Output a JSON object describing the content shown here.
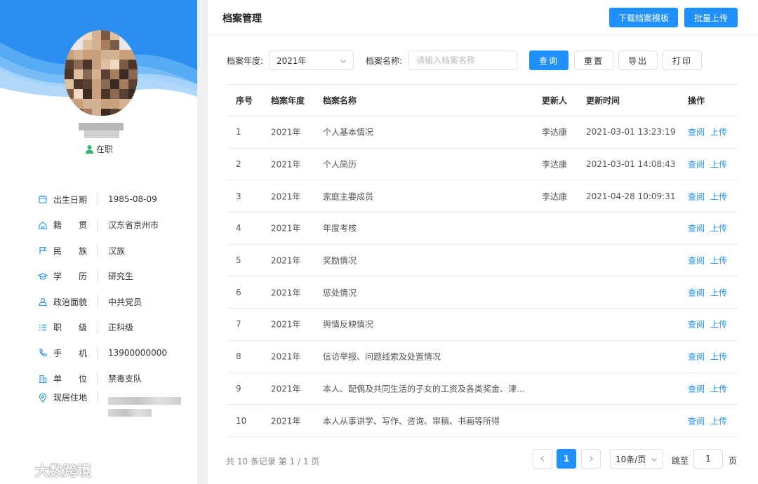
{
  "profile": {
    "status": "在职",
    "fields": [
      {
        "icon": "calendar-icon",
        "label": "出生日期",
        "value": "1985-08-09"
      },
      {
        "icon": "home-icon",
        "label": "籍　　贯",
        "value": "汉东省京州市"
      },
      {
        "icon": "flag-icon",
        "label": "民　　族",
        "value": "汉族"
      },
      {
        "icon": "graduation-cap-icon",
        "label": "学　　历",
        "value": "研究生"
      },
      {
        "icon": "party-icon",
        "label": "政治面貌",
        "value": "中共党员"
      },
      {
        "icon": "list-icon",
        "label": "职　　级",
        "value": "正科级"
      },
      {
        "icon": "phone-icon",
        "label": "手　　机",
        "value": "13900000000"
      },
      {
        "icon": "building-icon",
        "label": "单　　位",
        "value": "禁毒支队"
      },
      {
        "icon": "location-icon",
        "label": "现居住地",
        "value": ""
      }
    ]
  },
  "watermark": "大数跨境",
  "header": {
    "title": "档案管理",
    "download_label": "下载档案模板",
    "batch_upload_label": "批量上传"
  },
  "filters": {
    "year_label": "档案年度:",
    "year_value": "2021年",
    "name_label": "档案名称:",
    "name_placeholder": "请输入档案名称",
    "query_label": "查询",
    "reset_label": "重置",
    "export_label": "导出",
    "print_label": "打印"
  },
  "table": {
    "columns": [
      "序号",
      "档案年度",
      "档案名称",
      "更新人",
      "更新时间",
      "操作"
    ],
    "view_label": "查阅",
    "upload_label": "上传",
    "rows": [
      {
        "idx": "1",
        "year": "2021年",
        "name": "个人基本情况",
        "user": "李达康",
        "time": "2021-03-01 13:23:19"
      },
      {
        "idx": "2",
        "year": "2021年",
        "name": "个人简历",
        "user": "李达康",
        "time": "2021-03-01 14:08:43"
      },
      {
        "idx": "3",
        "year": "2021年",
        "name": "家庭主要成员",
        "user": "李达康",
        "time": "2021-04-28 10:09:31"
      },
      {
        "idx": "4",
        "year": "2021年",
        "name": "年度考核",
        "user": "",
        "time": ""
      },
      {
        "idx": "5",
        "year": "2021年",
        "name": "奖励情况",
        "user": "",
        "time": ""
      },
      {
        "idx": "6",
        "year": "2021年",
        "name": "惩处情况",
        "user": "",
        "time": ""
      },
      {
        "idx": "7",
        "year": "2021年",
        "name": "舆情反映情况",
        "user": "",
        "time": ""
      },
      {
        "idx": "8",
        "year": "2021年",
        "name": "信访举报、问题线索及处置情况",
        "user": "",
        "time": ""
      },
      {
        "idx": "9",
        "year": "2021年",
        "name": "本人、配偶及共同生活的子女的工资及各类奖金、津...",
        "user": "",
        "time": ""
      },
      {
        "idx": "10",
        "year": "2021年",
        "name": "本人从事讲学、写作、咨询、审稿、书画等所得",
        "user": "",
        "time": ""
      }
    ]
  },
  "pagination": {
    "total_text": "共 10 条记录 第 1 / 1 页",
    "current_page": "1",
    "page_size": "10条/页",
    "jump_label": "跳至",
    "jump_value": "1",
    "page_unit": "页"
  },
  "colors": {
    "accent": "#1e90ff",
    "banner": "#2196f3"
  }
}
